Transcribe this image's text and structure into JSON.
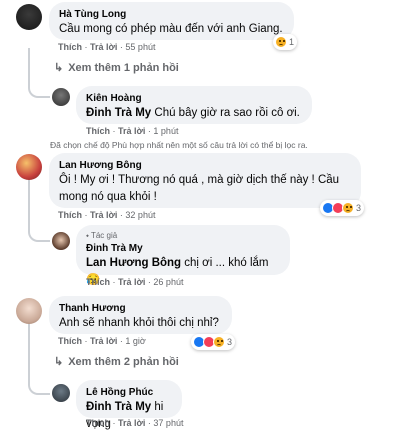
{
  "labels": {
    "like": "Thích",
    "reply": "Trả lời"
  },
  "c1": {
    "name": "Hà Tùng Long",
    "text": "Cầu mong có phép màu đến với anh Giang.",
    "time": "55 phút",
    "reactions": "1"
  },
  "more1": "Xem thêm 1 phản hồi",
  "r1": {
    "name": "Kiên Hoàng",
    "tag": "Đinh Trà My",
    "text": " Chú bây giờ ra sao rồi cô ơi.",
    "time": "1 phút"
  },
  "filter_note": "Đã chọn chế độ Phù hợp nhất nên một số câu trả lời có thể bị lọc ra.",
  "c2": {
    "name": "Lan Hương Bông",
    "text": "Ôi ! My ơi ! Thương nó quá , mà giờ dịch thế này ! Cầu mong nó qua khỏi !",
    "time": "32 phút",
    "reactions": "3"
  },
  "r2": {
    "author_badge": "Tác giả",
    "name": "Đinh Trà My",
    "tag": "Lan Hương Bông",
    "text": " chị ơi ... khó lắm",
    "emoji": "😥",
    "time": "26 phút"
  },
  "c3": {
    "name": "Thanh Hương",
    "text": "Anh sẽ nhanh khỏi thôi chị nhỉ?",
    "time": "1 giờ",
    "reactions": "3"
  },
  "more2": "Xem thêm 2 phản hồi",
  "r3": {
    "name": "Lê Hồng Phúc",
    "tag": "Đinh Trà My",
    "text": " hi vọng",
    "time": "37 phút"
  },
  "colors": {
    "bubble": "#f0f2f5",
    "meta": "#65676b",
    "like": "#1877f2",
    "love": "#f33e58",
    "sad": "#f7b125"
  }
}
